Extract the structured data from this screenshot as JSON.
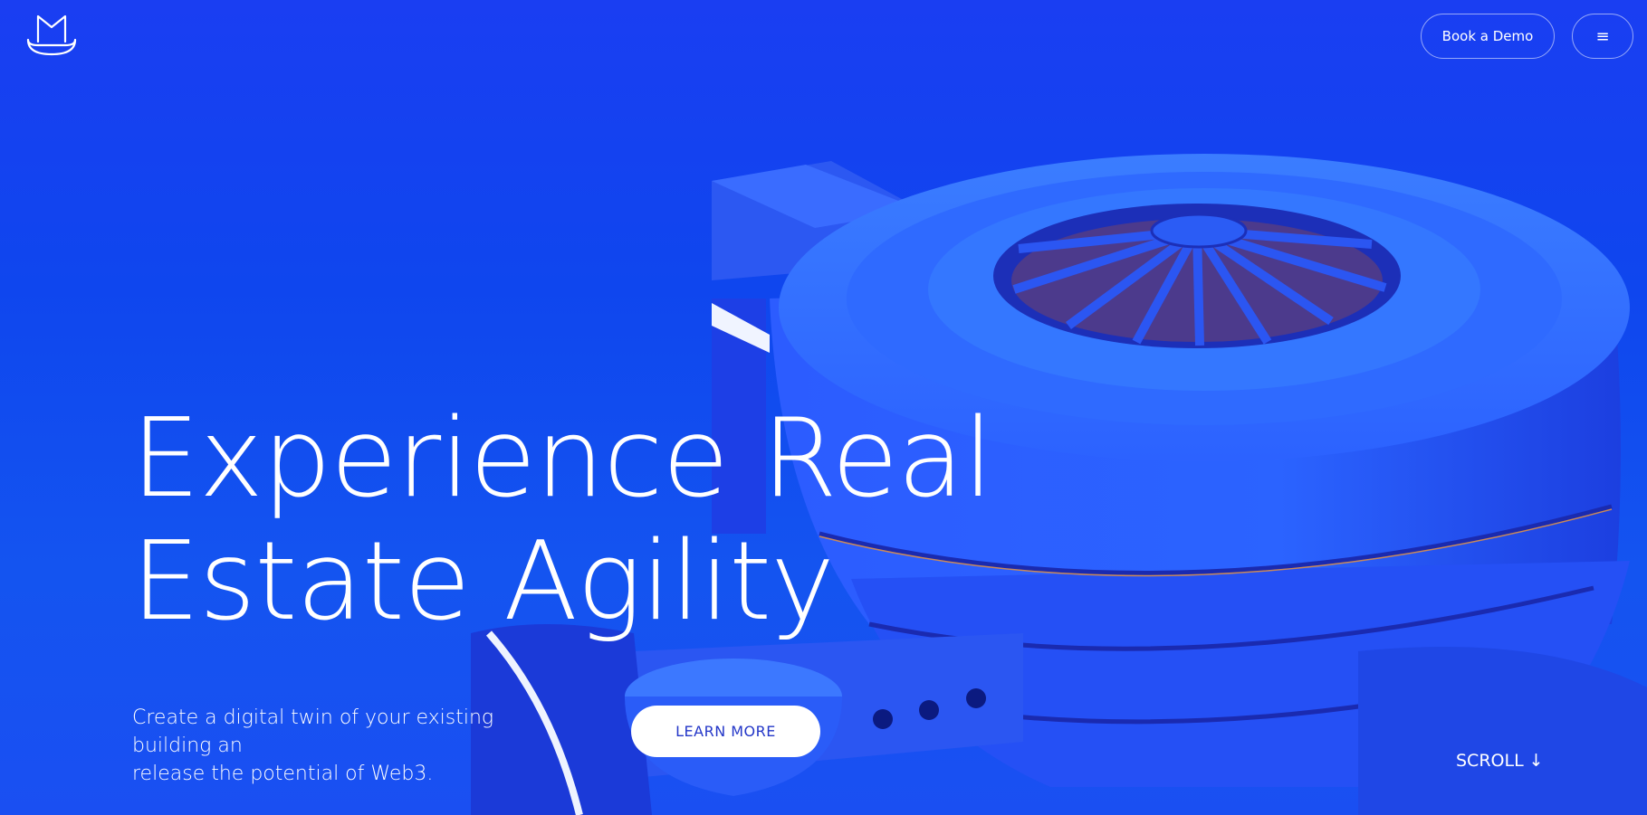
{
  "header": {
    "logo_icon": "mask-hat-logo-icon",
    "book_demo_label": "Book a Demo",
    "menu_icon": "hamburger-menu-icon",
    "menu_glyph": "≡"
  },
  "hero": {
    "headline_line1": "Experience Real",
    "headline_line2": "Estate Agility",
    "subtext_line1": "Create a digital twin of your existing building an",
    "subtext_line2": "release the potential of Web3.",
    "learn_more_label": "LEARN MORE",
    "scroll_label": "SCROLL",
    "scroll_icon": "arrow-down-icon",
    "scroll_glyph": "↓"
  },
  "colors": {
    "background": "#1a3ef2",
    "building": "#2a6cff",
    "button_text": "#2437c8"
  }
}
